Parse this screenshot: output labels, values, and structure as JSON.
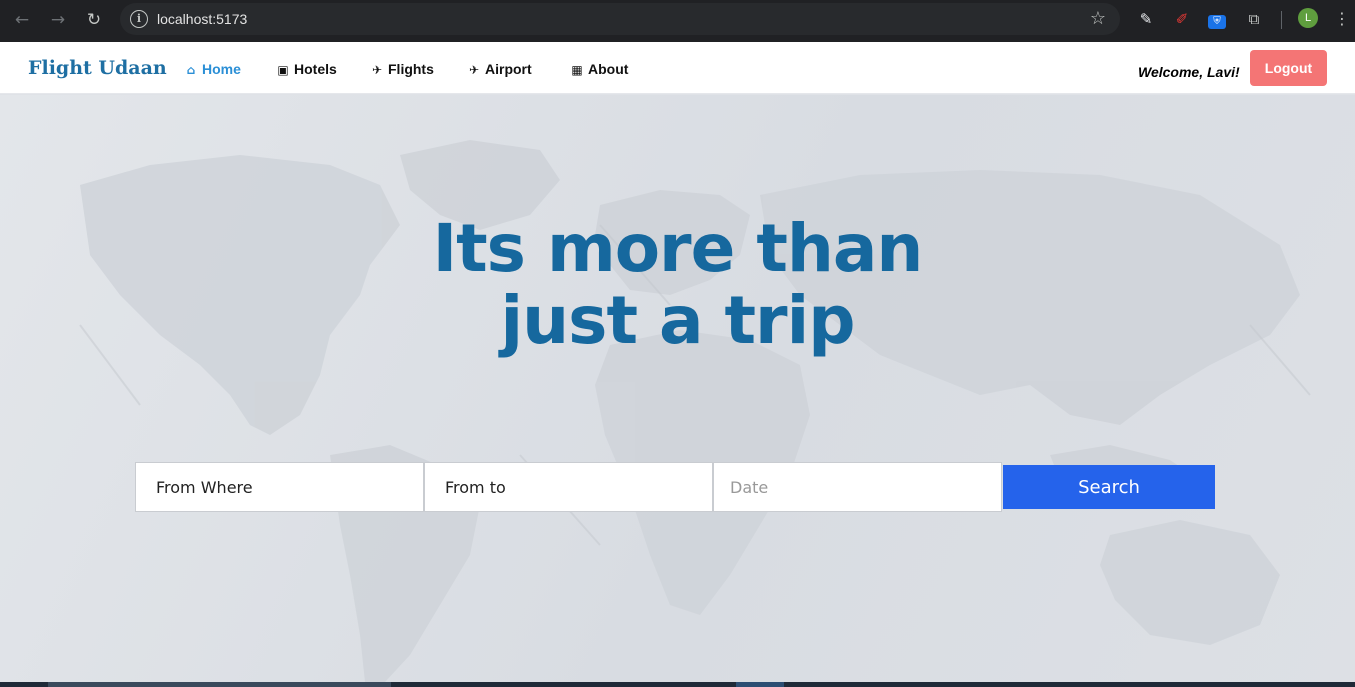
{
  "browser": {
    "url": "localhost:5173",
    "profile_initial": "L",
    "icons": [
      "back-icon",
      "forward-icon",
      "reload-icon",
      "info-icon",
      "star-icon",
      "eyedropper-icon",
      "pen-icon",
      "bitwarden-icon",
      "extensions-icon",
      "menu-icon"
    ]
  },
  "navbar": {
    "brand": "Flight Udaan",
    "items": [
      {
        "label": "Home",
        "icon": "home-icon",
        "active": true
      },
      {
        "label": "Hotels",
        "icon": "suitcase-icon",
        "active": false
      },
      {
        "label": "Flights",
        "icon": "plane-icon",
        "active": false
      },
      {
        "label": "Airport",
        "icon": "plane-departure-icon",
        "active": false
      },
      {
        "label": "About",
        "icon": "building-icon",
        "active": false
      }
    ],
    "welcome": "Welcome, Lavi!",
    "logout_label": "Logout"
  },
  "hero": {
    "headline_line1": "Its more than",
    "headline_line2": "just a trip"
  },
  "search": {
    "from_placeholder": "From Where",
    "to_placeholder": "From to",
    "date_placeholder": "Date",
    "button_label": "Search"
  },
  "colors": {
    "brand": "#1e6fa3",
    "active_nav": "#2b8fd6",
    "headline": "#16689e",
    "logout_bg": "#f47575",
    "search_bg": "#2563eb"
  }
}
